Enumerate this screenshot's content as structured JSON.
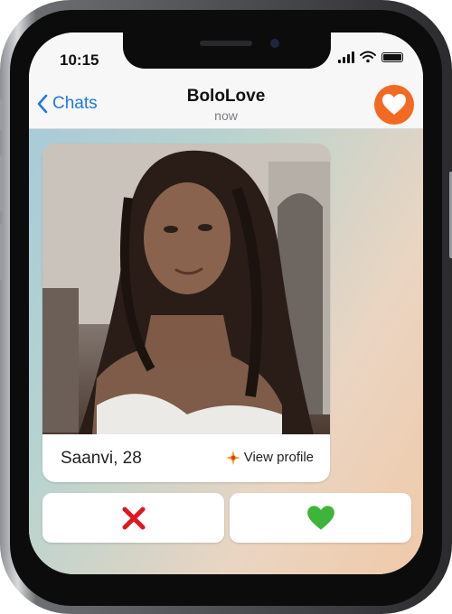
{
  "status_bar": {
    "time": "10:15",
    "icons": [
      "cellular-signal-icon",
      "wifi-icon",
      "battery-icon"
    ]
  },
  "navbar": {
    "back_label": "Chats",
    "title": "BoloLove",
    "subtitle": "now",
    "avatar_icon": "heart-icon",
    "accent_color": "#1f7ae0",
    "avatar_color": "#f26a21"
  },
  "card": {
    "name_age": "Saanvi, 28",
    "view_profile_label": "View profile",
    "view_profile_icon": "sparkle-icon"
  },
  "actions": {
    "dislike_icon": "cross-mark-icon",
    "like_icon": "green-heart-icon",
    "dislike_color": "#e0161f",
    "like_color": "#3fb43a"
  }
}
